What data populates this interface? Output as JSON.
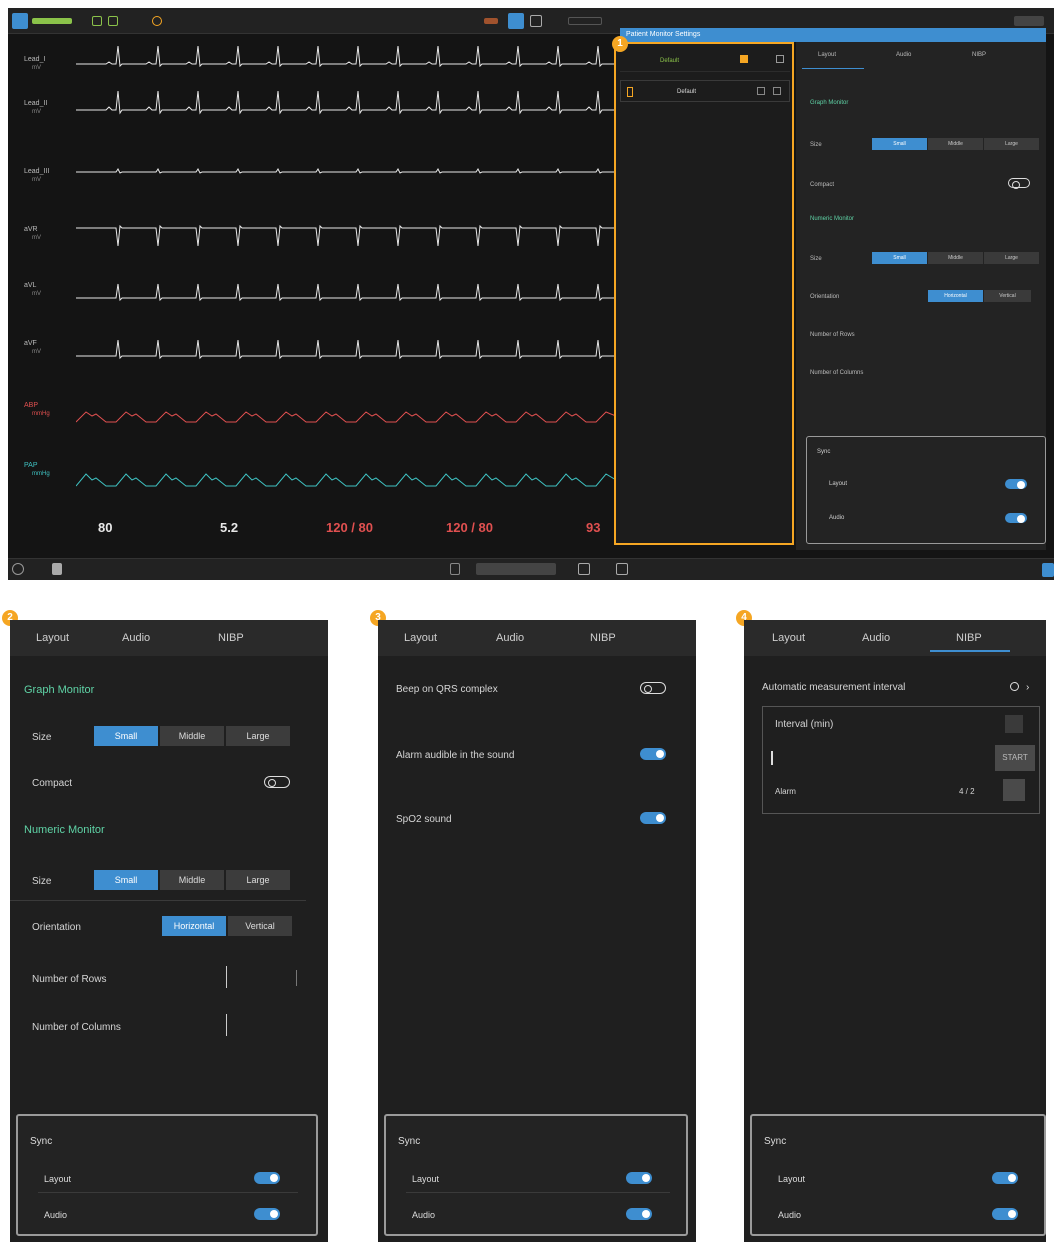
{
  "monitor": {
    "leads": [
      {
        "name": "Lead_I",
        "unit": "mV"
      },
      {
        "name": "Lead_II",
        "unit": "mV"
      },
      {
        "name": "Lead_III",
        "unit": "mV"
      },
      {
        "name": "aVR",
        "unit": "mV"
      },
      {
        "name": "aVL",
        "unit": "mV"
      },
      {
        "name": "aVF",
        "unit": "mV"
      },
      {
        "name": "ABP",
        "unit": "mmHg"
      },
      {
        "name": "PAP",
        "unit": "mmHg"
      }
    ],
    "vitals": {
      "hr": "80",
      "resp": "5.2",
      "abp": "120 / 80",
      "nibp": "120 / 80",
      "spo2": "93"
    },
    "panel_header": "Patient Monitor Settings",
    "list": [
      {
        "name": "Default",
        "selected": true
      },
      {
        "name": "Default",
        "selected": false
      }
    ],
    "settings": {
      "tabs": [
        "Layout",
        "Audio",
        "NIBP"
      ],
      "graph_section": "Graph Monitor",
      "size_label": "Size",
      "sizes": [
        "Small",
        "Middle",
        "Large"
      ],
      "compact_label": "Compact",
      "numeric_section": "Numeric Monitor",
      "orientation_label": "Orientation",
      "orientations": [
        "Horizontal",
        "Vertical"
      ],
      "rows_label": "Number of Rows",
      "cols_label": "Number of Columns",
      "sync_title": "Sync",
      "sync_layout": "Layout",
      "sync_audio": "Audio"
    },
    "badge": "1"
  },
  "phone2": {
    "badge": "2",
    "tabs": [
      "Layout",
      "Audio",
      "NIBP"
    ],
    "graph_section": "Graph Monitor",
    "size_label": "Size",
    "sizes": [
      "Small",
      "Middle",
      "Large"
    ],
    "compact_label": "Compact",
    "numeric_section": "Numeric Monitor",
    "size2_label": "Size",
    "sizes2": [
      "Small",
      "Middle",
      "Large"
    ],
    "orientation_label": "Orientation",
    "orientations": [
      "Horizontal",
      "Vertical"
    ],
    "rows_label": "Number of Rows",
    "cols_label": "Number of Columns",
    "sync_title": "Sync",
    "sync_layout": "Layout",
    "sync_audio": "Audio"
  },
  "phone3": {
    "badge": "3",
    "tabs": [
      "Layout",
      "Audio",
      "NIBP"
    ],
    "row1": "Beep on QRS complex",
    "row2": "Alarm audible in the sound",
    "row3": "SpO2 sound",
    "sync_title": "Sync",
    "sync_layout": "Layout",
    "sync_audio": "Audio"
  },
  "phone4": {
    "badge": "4",
    "tabs": [
      "Layout",
      "Audio",
      "NIBP"
    ],
    "header": "Automatic measurement interval",
    "card_row1": "Interval (min)",
    "card_row2_btn": "START",
    "card_row3": "Alarm",
    "card_row3_val": "4 / 2",
    "sync_title": "Sync",
    "sync_layout": "Layout",
    "sync_audio": "Audio"
  }
}
